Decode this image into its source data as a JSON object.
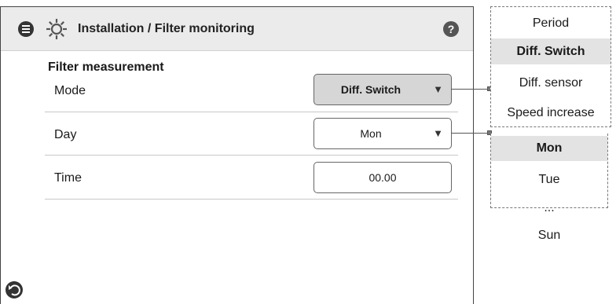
{
  "header": {
    "title": "Installation / Filter monitoring",
    "help_label": "?"
  },
  "section": {
    "title": "Filter measurement"
  },
  "rows": [
    {
      "label": "Mode",
      "value": "Diff. Switch",
      "type": "select"
    },
    {
      "label": "Day",
      "value": "Mon",
      "type": "select"
    },
    {
      "label": "Time",
      "value": "00.00",
      "type": "input"
    }
  ],
  "mode_options": [
    "Period",
    "Diff. Switch",
    "Diff. sensor",
    "Speed increase"
  ],
  "mode_selected": "Diff. Switch",
  "day_options": [
    "Mon",
    "Tue",
    "...",
    "Sun"
  ],
  "day_selected": "Mon",
  "icons": [
    "menu-icon",
    "gear-icon",
    "help-icon",
    "back-icon",
    "dropdown-arrow-icon"
  ],
  "colors": {
    "header_bg": "#ebebeb",
    "selected_bg": "#d6d6d6",
    "text": "#1a1a1a"
  }
}
